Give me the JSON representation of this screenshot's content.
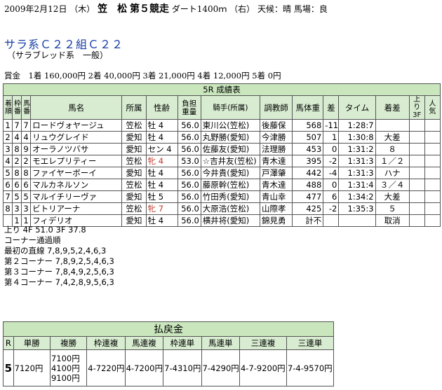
{
  "header": {
    "date": "2009年2月12日",
    "day": "（木）",
    "venue": "笠　松",
    "race": "第５競走",
    "course": "ダート1400ｍ",
    "direction": "（右）",
    "weather": "天候：晴",
    "track": "馬場：良"
  },
  "race_title": "サラ系Ｃ２２組Ｃ２２",
  "race_subtitle": "（サラブレッド系　一般）",
  "prize": "賞金　1着 160,000円 2着 40,000円 3着 21,000円 4着 12,000円 5着 0円",
  "results": {
    "caption": "5R 成績表",
    "headers": [
      "着順",
      "枠番",
      "馬番",
      "馬名",
      "所属",
      "性齢",
      "負担重量",
      "騎手(所属)",
      "調教師",
      "馬体重",
      "差",
      "タイム",
      "着差",
      "上り3F",
      "人気"
    ],
    "rows": [
      [
        "1",
        "7",
        "7",
        "ロードヴォヤージュ",
        "笠松",
        "牡 4",
        "56.0",
        "東川公(笠松)",
        "後藤保",
        "568",
        "-11",
        "1:28:7",
        "",
        "",
        ""
      ],
      [
        "2",
        "4",
        "4",
        "リュウグレイド",
        "愛知",
        "牡 4",
        "56.0",
        "丸野勝(愛知)",
        "今津勝",
        "507",
        "1",
        "1:30:8",
        "大差",
        "",
        ""
      ],
      [
        "3",
        "8",
        "9",
        "オーラノツバサ",
        "愛知",
        "セン 4",
        "56.0",
        "佐藤友(愛知)",
        "法理勝",
        "453",
        "0",
        "1:31:2",
        "８",
        "",
        ""
      ],
      [
        "4",
        "2",
        "2",
        "モエレプリティー",
        "笠松",
        "牝 4",
        "53.0",
        "☆吉井友(笠松)",
        "青木達",
        "395",
        "-2",
        "1:31:3",
        "１／２",
        "",
        ""
      ],
      [
        "5",
        "8",
        "8",
        "ファイヤーボーイ",
        "愛知",
        "牡 4",
        "56.0",
        "今井貴(愛知)",
        "戸澤肇",
        "442",
        "-4",
        "1:31:3",
        "ハナ",
        "",
        ""
      ],
      [
        "6",
        "6",
        "6",
        "マルカネルソン",
        "笠松",
        "牡 4",
        "56.0",
        "藤原幹(笠松)",
        "青木達",
        "488",
        "0",
        "1:31:4",
        "３／４",
        "",
        ""
      ],
      [
        "7",
        "5",
        "5",
        "マルイチリーヴァ",
        "愛知",
        "牡 5",
        "56.0",
        "竹田秀(愛知)",
        "青山幸",
        "477",
        "6",
        "1:34:2",
        "大差",
        "",
        ""
      ],
      [
        "8",
        "3",
        "3",
        "ビトリアーナ",
        "笠松",
        "牝 7",
        "56.0",
        "大原浩(笠松)",
        "山際孝",
        "425",
        "-2",
        "1:35:3",
        "５",
        "",
        ""
      ],
      [
        "",
        "1",
        "1",
        "フィデリオ",
        "愛知",
        "牡 4",
        "56.0",
        "横井将(愛知)",
        "錦見勇",
        "計不",
        "",
        "",
        "取消",
        "",
        ""
      ]
    ],
    "red_sex_rows": [
      3,
      7
    ]
  },
  "agari": "上り  4F 51.0  3F 37.8",
  "corners": {
    "title": "コーナー通過順",
    "first": "最初の直線 7,8,9,5,2,4,6,3",
    "c2": "第２コーナー 7,8,9,2,5,4,6,3",
    "c3": "第３コーナー 7,8,4,9,2,5,6,3",
    "c4": "第４コーナー 7,4,2,8,9,5,6,3"
  },
  "payout": {
    "caption": "払戻金",
    "headers": [
      "R",
      "単勝",
      "複勝",
      "枠連複",
      "馬連複",
      "枠連単",
      "馬連単",
      "三連複",
      "三連単"
    ],
    "race": "5",
    "tansho_num": "7",
    "tansho_amt": "120円",
    "fukusho": [
      [
        "7",
        "100円"
      ],
      [
        "4",
        "100円"
      ],
      [
        "9",
        "100円"
      ]
    ],
    "wakuren_fuku": [
      "4-7",
      "220円"
    ],
    "umaren_fuku": [
      "4-7",
      "200円"
    ],
    "wakuren_tan": [
      "7-4",
      "310円"
    ],
    "umaren_tan": [
      "7-4",
      "290円"
    ],
    "sanren_fuku": [
      "4-7-9",
      "200円"
    ],
    "sanren_tan": [
      "7-4-9",
      "570円"
    ]
  }
}
